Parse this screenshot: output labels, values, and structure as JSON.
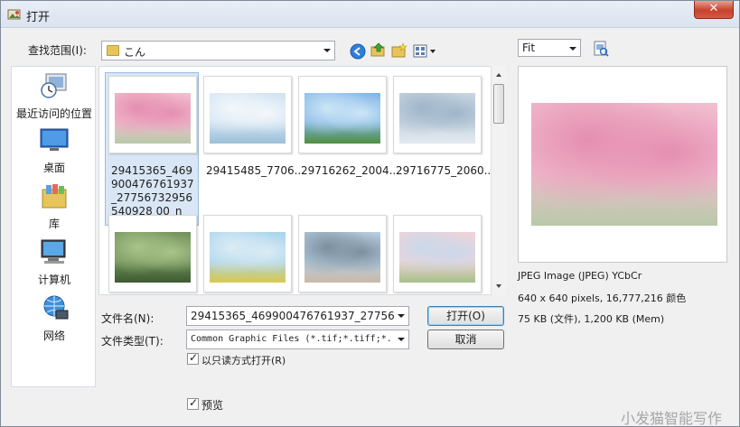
{
  "window": {
    "title": "打开",
    "close_label": "✕"
  },
  "look_in": {
    "label": "查找范围(I):",
    "value": "こん"
  },
  "places": [
    {
      "label": "最近访问的位置",
      "icon": "recent-places-icon"
    },
    {
      "label": "桌面",
      "icon": "desktop-icon"
    },
    {
      "label": "库",
      "icon": "library-icon"
    },
    {
      "label": "计算机",
      "icon": "computer-icon"
    },
    {
      "label": "网络",
      "icon": "network-icon"
    }
  ],
  "files": [
    {
      "name": "29415365_469900476761937_27756732956540928 00_n",
      "colors": [
        "#f2bfd0",
        "#e58fb0",
        "#b7c9a8"
      ],
      "selected": true
    },
    {
      "name": "29415485_7706...",
      "colors": [
        "#cfe3f2",
        "#f4f7fa",
        "#9cc0d8"
      ],
      "selected": false
    },
    {
      "name": "29716262_2004...",
      "colors": [
        "#7fb4e6",
        "#cde6f6",
        "#4f8f3f"
      ],
      "selected": false
    },
    {
      "name": "29716775_2060...",
      "colors": [
        "#c9d6e2",
        "#9fb6c9",
        "#e3e9ef"
      ],
      "selected": false
    },
    {
      "name": "",
      "colors": [
        "#6f8f58",
        "#a9c48a",
        "#3d5a31"
      ],
      "selected": false
    },
    {
      "name": "",
      "colors": [
        "#a8d4ec",
        "#dcecf4",
        "#d9c94a"
      ],
      "selected": false
    },
    {
      "name": "",
      "colors": [
        "#b8cfe0",
        "#7c8f9e",
        "#c9b9a8"
      ],
      "selected": false
    },
    {
      "name": "",
      "colors": [
        "#f1d3d8",
        "#c9d8ea",
        "#a6c08a"
      ],
      "selected": false
    }
  ],
  "file_name": {
    "label": "文件名(N):",
    "value": "29415365_469900476761937_277567329565"
  },
  "file_type": {
    "label": "文件类型(T):",
    "value": "Common Graphic Files (*.tif;*.tiff;*."
  },
  "buttons": {
    "open": "打开(O)",
    "cancel": "取消"
  },
  "read_only": {
    "label": "以只读方式打开(R)",
    "checked": true
  },
  "preview_toggle": {
    "label": "预览",
    "checked": true
  },
  "preview": {
    "zoom_value": "Fit",
    "info_line1": "JPEG Image (JPEG) YCbCr",
    "info_line2": "640 x 640 pixels, 16,777,216 颜色",
    "info_line3": "75 KB (文件), 1,200 KB (Mem)"
  },
  "watermark": "小发猫智能写作"
}
